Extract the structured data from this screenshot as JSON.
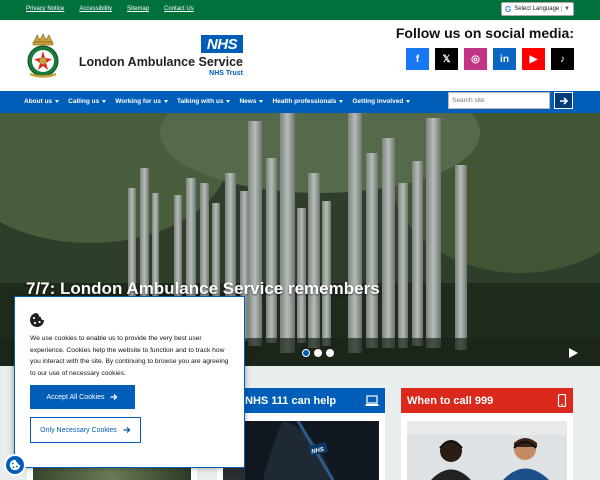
{
  "top_links": [
    "Privacy Notice",
    "Accessibility",
    "Sitemap",
    "Contact Us"
  ],
  "language": {
    "label": "Select Language",
    "g": "G",
    "caret": "▼"
  },
  "brand": {
    "nhs": "NHS",
    "name": "London Ambulance Service",
    "trust": "NHS Trust"
  },
  "social": {
    "heading": "Follow us on social media:",
    "items": [
      {
        "name": "facebook",
        "glyph": "f",
        "color": "#1877f2"
      },
      {
        "name": "x",
        "glyph": "𝕏",
        "color": "#000000"
      },
      {
        "name": "instagram",
        "glyph": "◎",
        "color": "#c13584"
      },
      {
        "name": "linkedin",
        "glyph": "in",
        "color": "#0a66c2"
      },
      {
        "name": "youtube",
        "glyph": "▶",
        "color": "#ff0000"
      },
      {
        "name": "tiktok",
        "glyph": "♪",
        "color": "#010101"
      }
    ]
  },
  "nav": {
    "items": [
      "About us",
      "Calling us",
      "Working for us",
      "Talking with us",
      "News",
      "Health professionals",
      "Getting involved"
    ],
    "search_placeholder": "Search site"
  },
  "hero": {
    "title": "7/7: London Ambulance Service remembers",
    "slides": 3,
    "active_slide": 1
  },
  "cards": [
    {
      "title": "NHS 111 can help",
      "color": "#005eb8",
      "icon": "laptop-icon"
    },
    {
      "title": "When to call 999",
      "color": "#da291c",
      "icon": "mobile-phone-icon"
    }
  ],
  "cookie": {
    "text": "We use cookies to enable us to provide the very best user experience. Cookies help the website to function and to track how you interact with the site. By continuing to browse you are agreeing to our use of necessary cookies.",
    "accept": "Accept All Cookies",
    "necessary": "Only Necessary Cookies"
  },
  "colors": {
    "green": "#00703c",
    "nhs_blue": "#005eb8",
    "red": "#da291c"
  }
}
